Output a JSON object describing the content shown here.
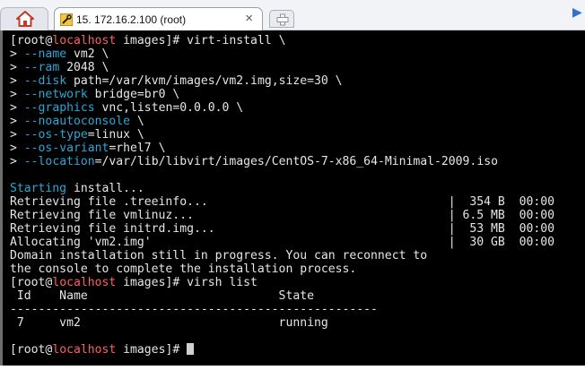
{
  "tabs": {
    "home_icon": "home-icon",
    "session_icon": "terminal-key-icon",
    "session_title": "15. 172.16.2.100 (root)",
    "close_glyph": "×",
    "new_tab_icon": "new-tab-icon",
    "scroll_arrow": "▶"
  },
  "colors": {
    "terminal_bg": "#000000",
    "text": "#e6e6e6",
    "hostname": "#ff5f5f",
    "option": "#28a8d8"
  },
  "terminal": {
    "lines": [
      [
        {
          "t": "[root@"
        },
        {
          "t": "localhost",
          "k": "h"
        },
        {
          "t": " images]# virt-install \\"
        }
      ],
      [
        {
          "t": "> "
        },
        {
          "t": "--name",
          "k": "c"
        },
        {
          "t": " vm2 \\"
        }
      ],
      [
        {
          "t": "> "
        },
        {
          "t": "--ram",
          "k": "c"
        },
        {
          "t": " 2048 \\"
        }
      ],
      [
        {
          "t": "> "
        },
        {
          "t": "--disk",
          "k": "c"
        },
        {
          "t": " path=/var/kvm/images/vm2.img,size=30 \\"
        }
      ],
      [
        {
          "t": "> "
        },
        {
          "t": "--network",
          "k": "c"
        },
        {
          "t": " bridge=br0 \\"
        }
      ],
      [
        {
          "t": "> "
        },
        {
          "t": "--graphics",
          "k": "c"
        },
        {
          "t": " vnc,listen=0.0.0.0 \\"
        }
      ],
      [
        {
          "t": "> "
        },
        {
          "t": "--noautoconsole",
          "k": "c"
        },
        {
          "t": " \\"
        }
      ],
      [
        {
          "t": "> "
        },
        {
          "t": "--os-type",
          "k": "c"
        },
        {
          "t": "=linux \\"
        }
      ],
      [
        {
          "t": "> "
        },
        {
          "t": "--os-variant",
          "k": "c"
        },
        {
          "t": "=rhel7 \\"
        }
      ],
      [
        {
          "t": "> "
        },
        {
          "t": "--location",
          "k": "c"
        },
        {
          "t": "=/var/lib/libvirt/images/CentOS-7-x86_64-Minimal-2009.iso"
        }
      ],
      [],
      [
        {
          "t": "Starting",
          "k": "c"
        },
        {
          "t": " install..."
        }
      ],
      [
        {
          "t": "Retrieving file .treeinfo...                                  |  354 B  00:00"
        }
      ],
      [
        {
          "t": "Retrieving file vmlinuz...                                    | 6.5 MB  00:00"
        }
      ],
      [
        {
          "t": "Retrieving file initrd.img...                                 |  53 MB  00:00"
        }
      ],
      [
        {
          "t": "Allocating 'vm2.img'                                          |  30 GB  00:00"
        }
      ],
      [
        {
          "t": "Domain installation still in progress. You can reconnect to"
        }
      ],
      [
        {
          "t": "the console to complete the installation process."
        }
      ],
      [
        {
          "t": "[root@"
        },
        {
          "t": "localhost",
          "k": "h"
        },
        {
          "t": " images]# virsh list"
        }
      ],
      [
        {
          "t": " Id    Name                           State"
        }
      ],
      [
        {
          "t": "----------------------------------------------------"
        }
      ],
      [
        {
          "t": " 7     vm2                            running"
        }
      ],
      [],
      [
        {
          "t": "[root@"
        },
        {
          "t": "localhost",
          "k": "h"
        },
        {
          "t": " images]# "
        }
      ]
    ]
  }
}
